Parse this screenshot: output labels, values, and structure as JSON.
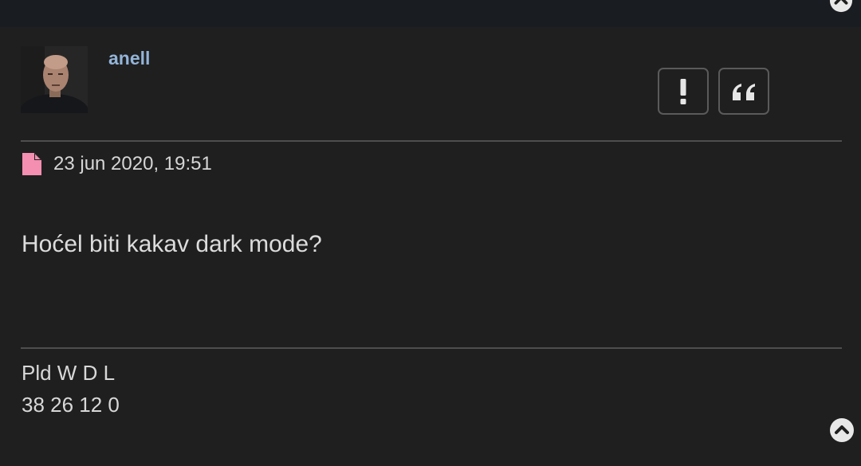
{
  "post": {
    "author": "anell",
    "date": "23 jun 2020, 19:51",
    "content": "Hoćel biti kakav dark mode?",
    "signature": {
      "line1": "Pld W D L",
      "line2": "38 26 12 0"
    }
  },
  "icons": {
    "report": "exclamation-icon",
    "quote": "quote-icon",
    "post": "file-icon",
    "scroll_top": "chevron-up-circle-icon"
  },
  "colors": {
    "username": "#93b4d8",
    "post_icon": "#f48fb1",
    "background": "#1f1f20"
  }
}
